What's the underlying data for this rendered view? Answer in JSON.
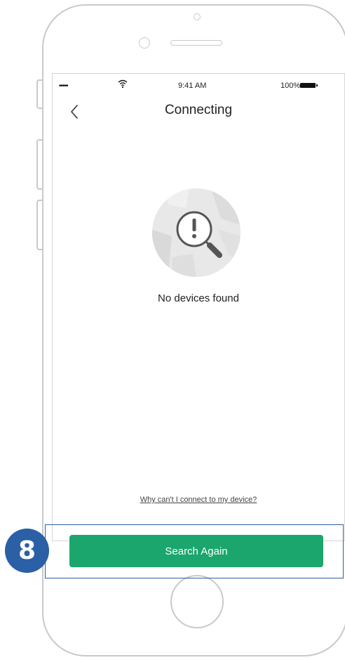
{
  "status_bar": {
    "signal": "•••••",
    "time": "9:41 AM",
    "battery_percent": "100%"
  },
  "nav": {
    "title": "Connecting",
    "back_icon": "chevron-left-icon"
  },
  "empty_state": {
    "icon": "search-alert-icon",
    "message": "No devices found"
  },
  "help_link": "Why can't I connect to my device?",
  "primary_action": {
    "label": "Search Again",
    "color": "#1aa66c"
  },
  "annotation": {
    "step_number": "8",
    "color": "#2b5fa6"
  }
}
